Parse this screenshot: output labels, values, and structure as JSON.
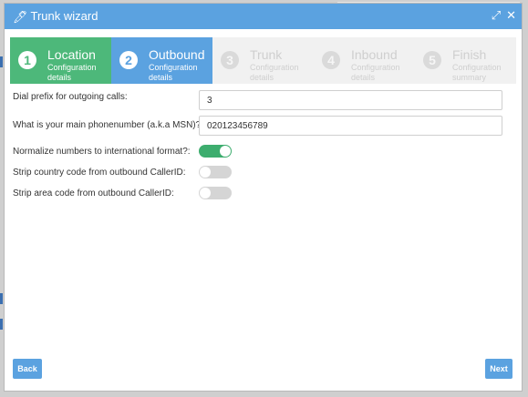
{
  "header": {
    "title": "Trunk wizard",
    "icons": [
      "magic-wand-icon",
      "expand-icon",
      "close-icon"
    ]
  },
  "steps": [
    {
      "num": "1",
      "name": "Location",
      "sub": "Configuration details",
      "state": "done"
    },
    {
      "num": "2",
      "name": "Outbound",
      "sub": "Configuration details",
      "state": "active"
    },
    {
      "num": "3",
      "name": "Trunk",
      "sub": "Configuration details",
      "state": "todo"
    },
    {
      "num": "4",
      "name": "Inbound",
      "sub": "Configuration details",
      "state": "todo"
    },
    {
      "num": "5",
      "name": "Finish",
      "sub": "Configuration summary",
      "state": "todo"
    }
  ],
  "form": {
    "dial_prefix": {
      "label": "Dial prefix for outgoing calls:",
      "value": "3"
    },
    "main_number": {
      "label": "What is your main phonenumber (a.k.a MSN)?:",
      "value": "020123456789"
    },
    "normalize": {
      "label": "Normalize numbers to international format?:",
      "on": true
    },
    "strip_country": {
      "label": "Strip country code from outbound CallerID:",
      "on": false
    },
    "strip_area": {
      "label": "Strip area code from outbound CallerID:",
      "on": false
    }
  },
  "footer": {
    "back_label": "Back",
    "next_label": "Next"
  },
  "colors": {
    "header": "#5ba2e0",
    "done": "#4db87a",
    "active": "#5ba2e0",
    "toggle_on": "#3dad6e"
  }
}
